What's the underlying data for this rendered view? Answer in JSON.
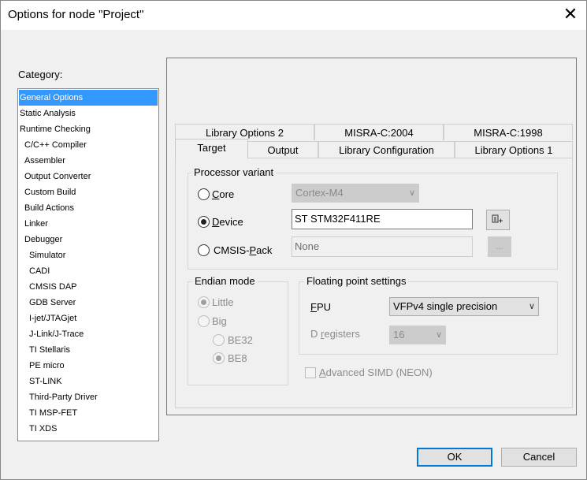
{
  "window": {
    "title": "Options for node \"Project\"",
    "close_glyph": "✕"
  },
  "category": {
    "label": "Category:",
    "items": [
      {
        "label": "General Options",
        "selected": true
      },
      {
        "label": "Static Analysis"
      },
      {
        "label": "Runtime Checking"
      },
      {
        "label": "C/C++ Compiler"
      },
      {
        "label": "Assembler"
      },
      {
        "label": "Output Converter"
      },
      {
        "label": "Custom Build"
      },
      {
        "label": "Build Actions"
      },
      {
        "label": "Linker"
      },
      {
        "label": "Debugger"
      },
      {
        "label": "Simulator"
      },
      {
        "label": "CADI"
      },
      {
        "label": "CMSIS DAP"
      },
      {
        "label": "GDB Server"
      },
      {
        "label": "I-jet/JTAGjet"
      },
      {
        "label": "J-Link/J-Trace"
      },
      {
        "label": "TI Stellaris"
      },
      {
        "label": "PE micro"
      },
      {
        "label": "ST-LINK"
      },
      {
        "label": "Third-Party Driver"
      },
      {
        "label": "TI MSP-FET"
      },
      {
        "label": "TI XDS"
      }
    ]
  },
  "tabs": {
    "row_back": [
      "Library Options 2",
      "MISRA-C:2004",
      "MISRA-C:1998"
    ],
    "row_front": [
      "Target",
      "Output",
      "Library Configuration",
      "Library Options 1"
    ],
    "active": "Target"
  },
  "processor_variant": {
    "title": "Processor variant",
    "core_label_pre": "C",
    "core_label_post": "ore",
    "core_value": "Cortex-M4",
    "device_label_pre": "D",
    "device_label_post": "evice",
    "device_value": "ST STM32F411RE",
    "device_selected": true,
    "cmsis_label_pre": "CMSIS-",
    "cmsis_label_u": "P",
    "cmsis_label_post": "ack",
    "cmsis_value": "None",
    "browse_glyph": "...",
    "device_icon": "device-select-icon"
  },
  "endian_mode": {
    "title": "Endian mode",
    "little": "Little",
    "big": "Big",
    "be32": "BE32",
    "be8": "BE8"
  },
  "floating_point": {
    "title": "Floating point settings",
    "fpu_label_pre": "F",
    "fpu_label_post": "PU",
    "fpu_value": "VFPv4 single precision",
    "dreg_label_pre": "D ",
    "dreg_label_u": "r",
    "dreg_label_post": "egisters",
    "dreg_value": "16",
    "simd_label_u": "A",
    "simd_label_post": "dvanced SIMD (NEON)"
  },
  "buttons": {
    "ok": "OK",
    "cancel": "Cancel"
  }
}
